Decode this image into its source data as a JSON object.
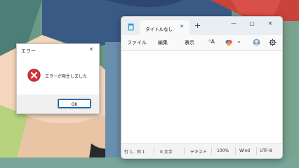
{
  "error_dialog": {
    "title": "エラー",
    "message": "エラーが発生しました",
    "ok_label": "OK",
    "close_glyph": "✕",
    "icon": "error-icon"
  },
  "notepad": {
    "tab_title": "タイトルなし",
    "tab_close_glyph": "✕",
    "new_tab_glyph": "+",
    "window_controls": {
      "minimize": "—",
      "maximize": "▢",
      "close": "✕"
    },
    "menu": {
      "file": "ファイル",
      "edit": "編集",
      "view": "表示"
    },
    "toolbar": {
      "font_glyph": "ᴬA",
      "dropdown_glyph": "⌄"
    },
    "status": {
      "position": "行 1、列 1",
      "chars": "0 文字",
      "format": "テキスト",
      "zoom": "100%",
      "line_ending": "Wind",
      "encoding": "UTF-8"
    }
  },
  "colors": {
    "accent": "#0067c0",
    "error_red": "#d13438"
  }
}
